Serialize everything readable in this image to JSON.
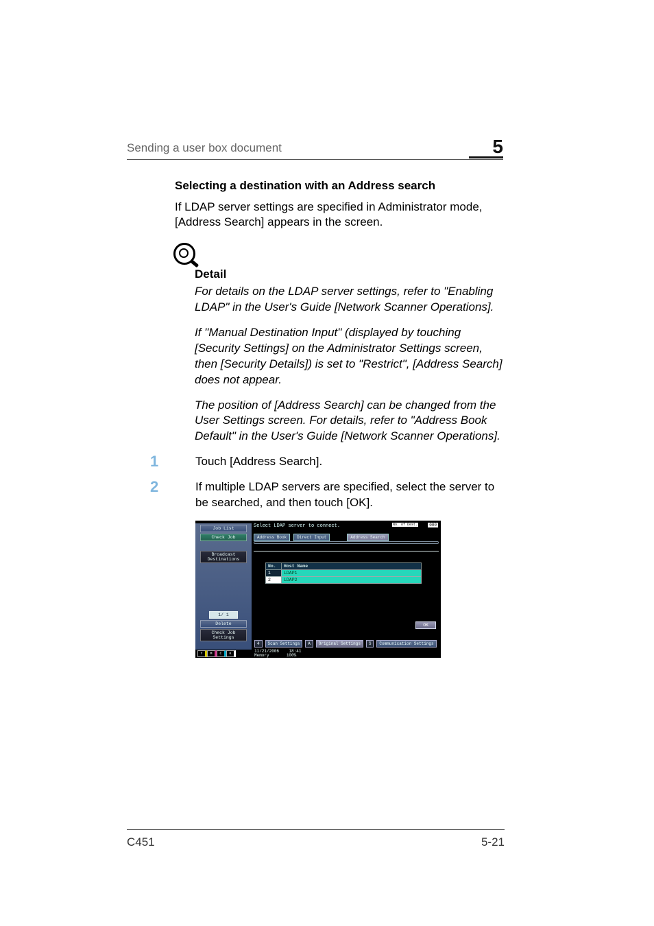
{
  "header": {
    "running_head": "Sending a user box document",
    "chapter_number": "5"
  },
  "section": {
    "title": "Selecting a destination with an Address search",
    "intro": "If LDAP server settings are specified in Administrator mode, [Address Search] appears in the screen."
  },
  "detail": {
    "heading": "Detail",
    "p1": "For details on the LDAP server settings, refer to \"Enabling LDAP\" in the User's Guide [Network Scanner Operations].",
    "p2": "If \"Manual Destination Input\" (displayed by touching [Security Settings] on the Administrator Settings screen, then [Security Details]) is set to \"Restrict\", [Address Search] does not appear.",
    "p3": "The position of [Address Search] can be changed from the User Settings screen. For details, refer to \"Address Book Default\" in the User's Guide [Network Scanner Operations]."
  },
  "steps": {
    "one_num": "1",
    "one_text": "Touch [Address Search].",
    "two_num": "2",
    "two_text": "If multiple LDAP servers are specified, select the server to be searched, and then touch [OK]."
  },
  "figure": {
    "header_msg": "Select LDAP server to connect.",
    "header_count_label": "No. of Dest.",
    "header_count_value": "000",
    "left": {
      "job_list": "Job List",
      "check_job": "Check Job",
      "broadcast": "Broadcast Destinations",
      "page": "1/  1",
      "delete": "Delete",
      "check_detail": "Check Job Settings"
    },
    "tabs": {
      "address_book": "Address Book",
      "direct_input": "Direct Input",
      "address_search": "Address Search"
    },
    "table": {
      "col_no": "No.",
      "col_host": "Host Name",
      "rows": [
        {
          "no": "1",
          "host": "LDAP1"
        },
        {
          "no": "2",
          "host": "LDAP2"
        }
      ]
    },
    "ok": "OK",
    "bottom": {
      "scan_icon": "Scan Settings",
      "original": "Original Settings",
      "comm": "Communication Settings",
      "four": "4",
      "a": "A",
      "s": "S"
    },
    "status": {
      "y": "Y",
      "m": "M",
      "c": "C",
      "k": "K",
      "date": "11/21/2006",
      "time": "18:41",
      "mem_label": "Memory",
      "mem_val": "100%"
    }
  },
  "footer": {
    "model": "C451",
    "page": "5-21"
  }
}
